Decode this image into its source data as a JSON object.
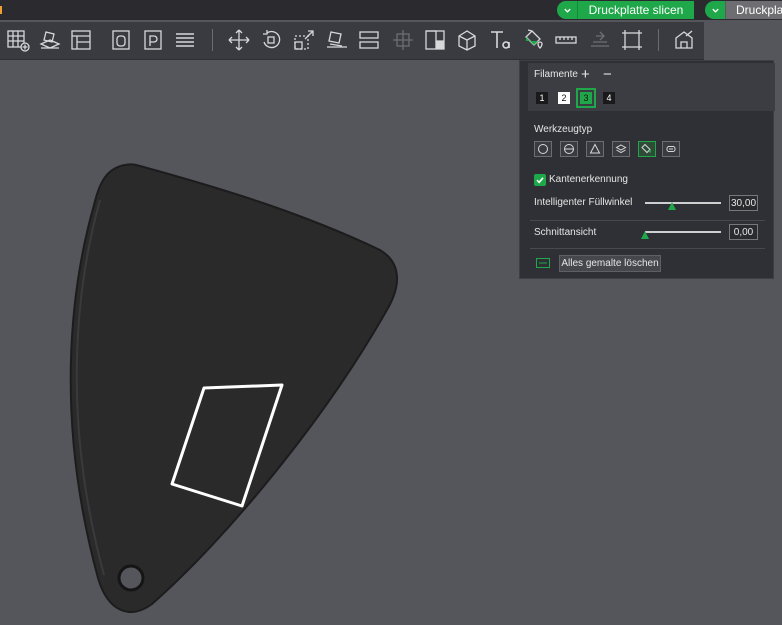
{
  "topbar": {
    "slice_label": "Druckplatte slicen",
    "print_label": "Druckplatte drucken",
    "accent_color": "#1ea84a"
  },
  "toolbar": {
    "tools": [
      "add-plate-icon",
      "import-model-icon",
      "arrange-icon",
      "orient-icon",
      "plate-p-icon",
      "layers-icon",
      "move-icon",
      "rotate-icon",
      "scale-icon",
      "lay-on-face-icon",
      "split-icon",
      "cut-icon",
      "mesh-boolean-icon",
      "support-paint-icon",
      "text-emboss-icon",
      "color-paint-icon",
      "measure-icon",
      "assembly-icon",
      "variable-layer-icon",
      "split-objects-icon"
    ]
  },
  "panel": {
    "filaments_label": "Filamente",
    "add_symbol": "+",
    "remove_symbol": "−",
    "filaments": [
      "1",
      "2",
      "3",
      "4"
    ],
    "selected_filament": "3",
    "tool_type_label": "Werkzeugtyp",
    "tool_types": [
      "circle-icon",
      "sphere-icon",
      "triangle-icon",
      "height-range-icon",
      "fill-icon",
      "gap-fill-icon"
    ],
    "edge_detection_label": "Kantenerkennung",
    "edge_detection_checked": true,
    "smart_fill_angle_label": "Intelligenter Füllwinkel",
    "smart_fill_angle_value": "30,00",
    "smart_fill_angle_fraction": 0.35,
    "section_view_label": "Schnittansicht",
    "section_view_value": "0,00",
    "section_view_fraction": 0.0,
    "clear_all_label": "Alles gemalte löschen"
  }
}
